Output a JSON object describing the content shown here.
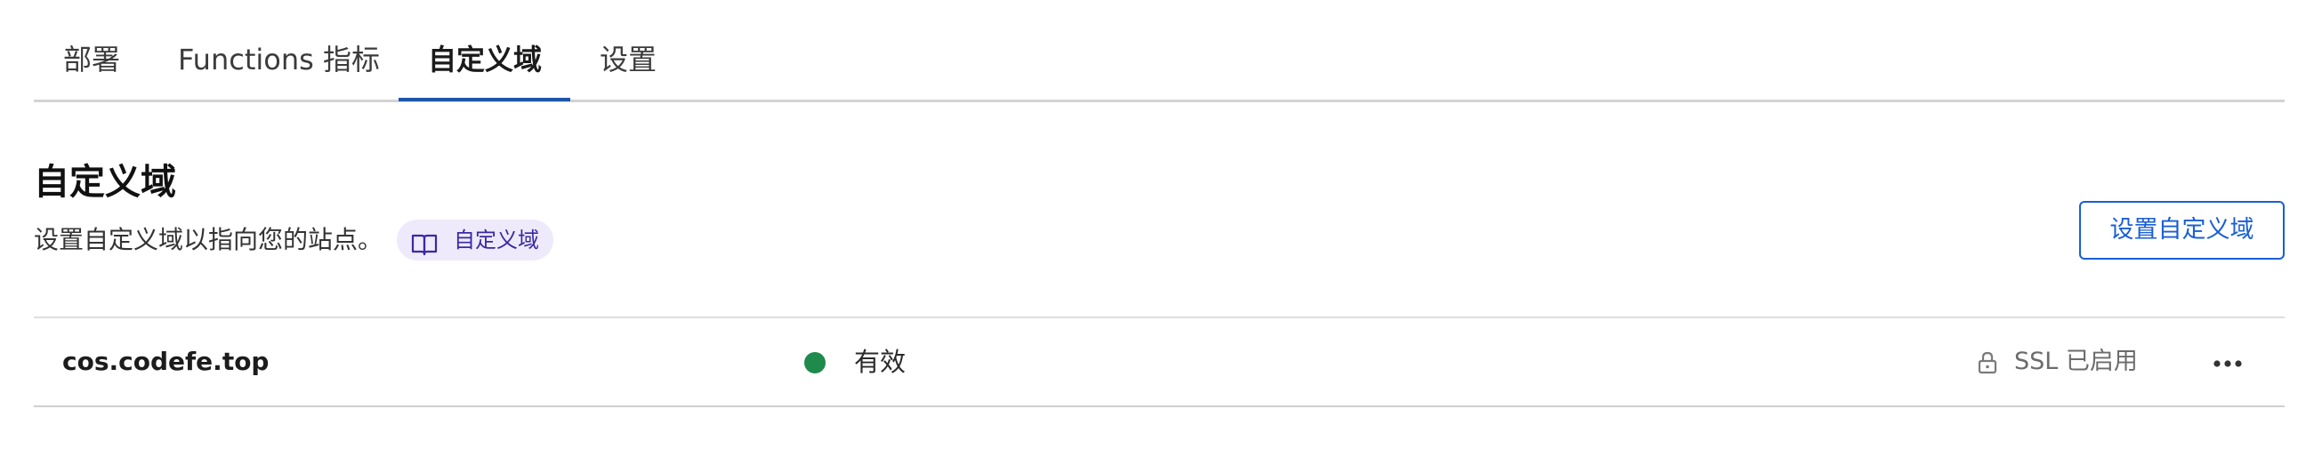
{
  "tabs": [
    {
      "label": "部署"
    },
    {
      "label": "Functions 指标"
    },
    {
      "label": "自定义域"
    },
    {
      "label": "设置"
    }
  ],
  "active_tab": "自定义域",
  "section": {
    "title": "自定义域",
    "description": "设置自定义域以指向您的站点。",
    "doc_link_label": "自定义域",
    "doc_icon": "book-icon",
    "action_button_label": "设置自定义域"
  },
  "domains": [
    {
      "name": "cos.codefe.top",
      "status": "有效",
      "status_color": "#1e8a4c",
      "ssl_label": "SSL 已启用",
      "ssl_icon": "lock-icon",
      "more_icon": "more-horizontal-icon"
    }
  ],
  "colors": {
    "accent": "#1a5fd4",
    "tab_underline": "#1f56a8",
    "pill_bg": "#eeeafb",
    "pill_text": "#3a2aa3"
  }
}
